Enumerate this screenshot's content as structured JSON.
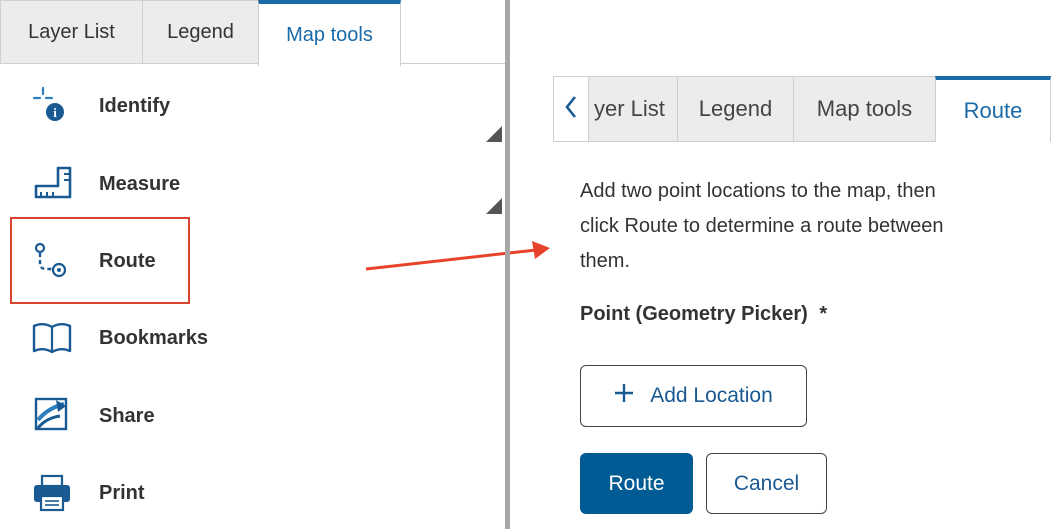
{
  "left_panel": {
    "tabs": [
      {
        "label": "Layer List"
      },
      {
        "label": "Legend"
      },
      {
        "label": "Map tools",
        "active": true
      }
    ],
    "tools": [
      {
        "label": "Identify",
        "icon": "identify-icon"
      },
      {
        "label": "Measure",
        "icon": "measure-icon"
      },
      {
        "label": "Route",
        "icon": "route-icon",
        "highlighted": true
      },
      {
        "label": "Bookmarks",
        "icon": "bookmarks-icon"
      },
      {
        "label": "Share",
        "icon": "share-icon"
      },
      {
        "label": "Print",
        "icon": "print-icon"
      }
    ]
  },
  "right_panel": {
    "back_icon": "chevron-left-icon",
    "tabs": [
      {
        "label": "yer List"
      },
      {
        "label": "Legend"
      },
      {
        "label": "Map tools"
      },
      {
        "label": "Route",
        "active": true
      }
    ],
    "description": "Add two point locations to the map, then click Route to determine a route between them.",
    "description_lines": [
      "Add two point locations to the map, then",
      "click Route to determine a route between",
      "them."
    ],
    "field_label": "Point (Geometry Picker)",
    "required_marker": "*",
    "add_location_label": "Add Location",
    "route_button_label": "Route",
    "cancel_button_label": "Cancel"
  },
  "colors": {
    "accent": "#1b6ba8",
    "button_primary": "#005a94",
    "highlight_border": "#d9442e",
    "arrow": "#e8432a",
    "divider": "#a7a7a7",
    "tab_bg": "#ececec"
  }
}
